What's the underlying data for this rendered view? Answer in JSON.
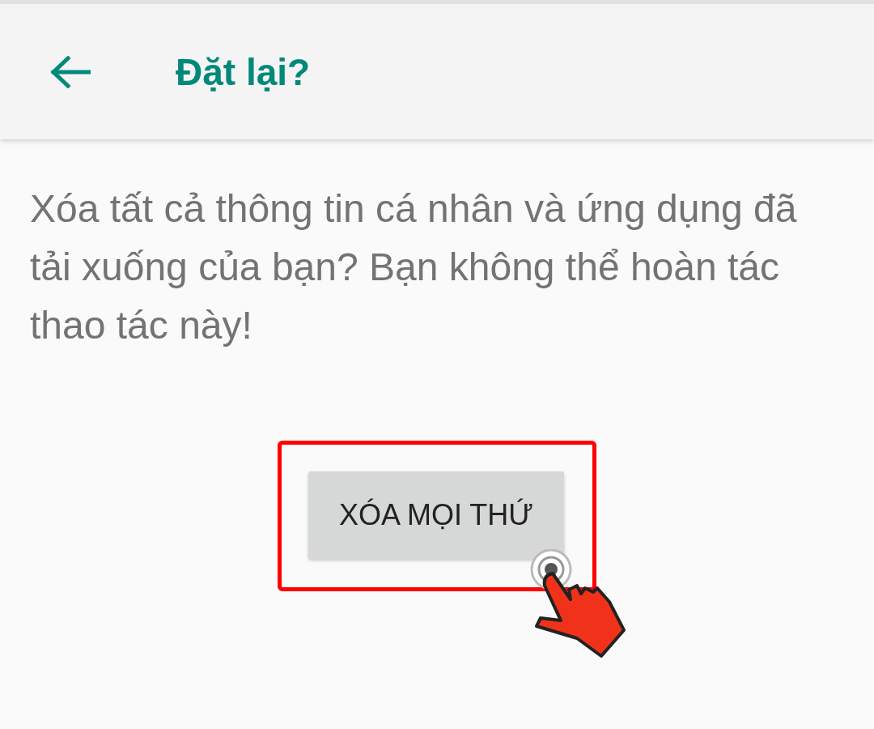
{
  "app_bar": {
    "title": "Đặt lại?"
  },
  "message": "Xóa tất cả thông tin cá nhân và ứng dụng đã tải xuống của bạn? Bạn không thể hoàn tác thao tác này!",
  "button": {
    "label": "XÓA MỌI THỨ"
  }
}
